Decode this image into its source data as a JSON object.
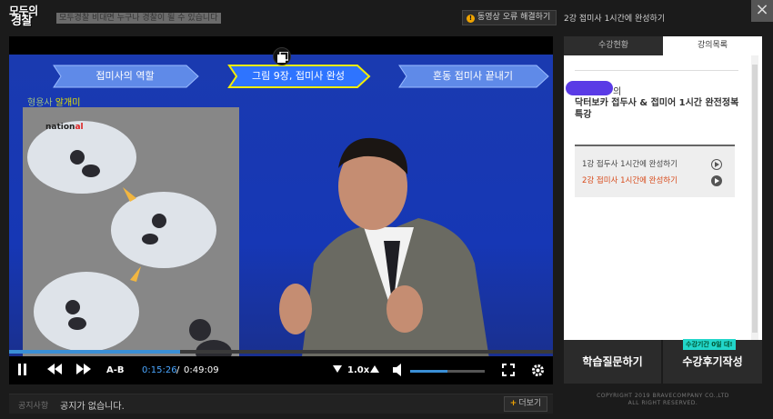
{
  "header": {
    "logo_line1": "모두의",
    "logo_line2": "경찰",
    "slogan": "모두경찰 비대면 누구나 경찰이 될 수 있습니다",
    "error_button": "동영상 오류 해결하기",
    "lecture_title": "2강 접미사 1시간에 완성하기",
    "close": "×"
  },
  "video": {
    "slide_tabs": [
      "접미사의 역할",
      "그림 9장, 접미사 완성",
      "혼동 접미사 끝내기"
    ],
    "board_caption_prefix": "형용사",
    "board_caption": "알개미",
    "board_brand": "nation",
    "board_brand_suffix": "al"
  },
  "controls": {
    "ab_label": "A-B",
    "time_current": "0:15:26",
    "time_separator": "/",
    "time_total": "0:49:09",
    "speed": "1.0x",
    "progress_fraction": 0.314,
    "volume_fraction": 0.5
  },
  "notice": {
    "label": "공지사항",
    "text": "공지가 없습니다.",
    "more_button": "더보기",
    "more_plus": "+"
  },
  "panel": {
    "tabs": [
      "수강현황",
      "강의목록"
    ],
    "active_tab": "강의목록",
    "course_suffix": "의",
    "course_name": "닥터보카 접두사 & 접미어 1시간 완전정복 특강",
    "lessons": [
      {
        "label": "1강 접두사 1시간에 완성하기",
        "active": false
      },
      {
        "label": "2강 접미사 1시간에 완성하기",
        "active": true
      }
    ]
  },
  "actions": {
    "qa_button": "학습질문하기",
    "review_button": "수강후기작성",
    "review_badge": "수강기간 0일 대!"
  },
  "footer": {
    "copyright_line1": "COPYRIGHT 2019 BRAVECOMPANY CO.,LTD",
    "copyright_line2": "ALL RIGHT RESERVED."
  },
  "colors": {
    "accent_blue": "#3a8fd6",
    "active_lesson": "#d84a1a",
    "badge": "#22d6ca",
    "warning": "#f0a400"
  }
}
